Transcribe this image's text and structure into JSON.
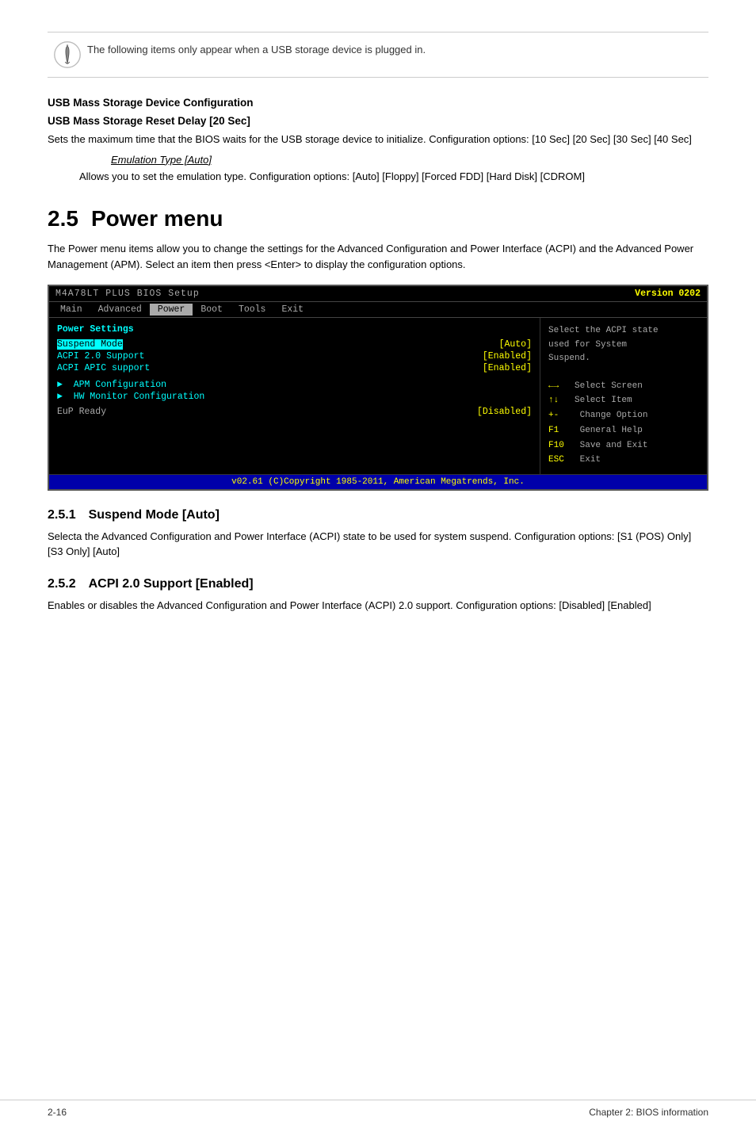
{
  "notice": {
    "text": "The following items only appear when a USB storage device is plugged in."
  },
  "usb_section": {
    "heading": "USB Mass Storage Device Configuration",
    "reset_delay_heading": "USB Mass Storage Reset Delay [20 Sec]",
    "reset_delay_body": "Sets the maximum time that the BIOS waits for the USB storage device to initialize. Configuration options: [10 Sec] [20 Sec] [30 Sec] [40 Sec]",
    "emulation_label": "Emulation Type [Auto]",
    "emulation_body": "Allows you to set the emulation type. Configuration options: [Auto] [Floppy] [Forced FDD] [Hard Disk] [CDROM]"
  },
  "power_section": {
    "num": "2.5",
    "title": "Power menu",
    "body": "The Power menu items allow you to change the settings for the Advanced Configuration and Power Interface (ACPI) and the Advanced Power Management (APM). Select an item then press <Enter> to display the configuration options.",
    "bios": {
      "header_title": "M4A78LT PLUS BIOS Setup",
      "version": "Version 0202",
      "menu_items": [
        "Main",
        "Advanced",
        "Power",
        "Boot",
        "Tools",
        "Exit"
      ],
      "active_menu": "Power",
      "section_label": "Power Settings",
      "rows": [
        {
          "key": "Suspend Mode",
          "val": "[Auto]",
          "highlight": true
        },
        {
          "key": "ACPI 2.0 Support",
          "val": "[Enabled]",
          "highlight": false
        },
        {
          "key": "ACPI APIC support",
          "val": "[Enabled]",
          "highlight": false
        }
      ],
      "submenus": [
        "APM Configuration",
        "HW Monitor Configuration"
      ],
      "eup_key": "EuP Ready",
      "eup_val": "[Disabled]",
      "right_help_lines": [
        "Select the ACPI state",
        "used for System",
        "Suspend."
      ],
      "right_keys": [
        {
          "sym": "↔",
          "label": "Select Screen"
        },
        {
          "sym": "↕",
          "label": "Select Item"
        },
        {
          "sym": "+-",
          "label": "Change Option"
        },
        {
          "sym": "F1",
          "label": "General Help"
        },
        {
          "sym": "F10",
          "label": "Save and Exit"
        },
        {
          "sym": "ESC",
          "label": "Exit"
        }
      ],
      "footer": "v02.61 (C)Copyright 1985-2011, American Megatrends, Inc."
    }
  },
  "subsections": [
    {
      "num": "2.5.1",
      "title": "Suspend Mode [Auto]",
      "body": "Selecta the Advanced Configuration and Power Interface (ACPI) state to be used for system suspend. Configuration options: [S1 (POS) Only] [S3 Only] [Auto]"
    },
    {
      "num": "2.5.2",
      "title": "ACPI 2.0 Support [Enabled]",
      "body": "Enables or disables the Advanced Configuration and Power Interface (ACPI) 2.0 support. Configuration options: [Disabled] [Enabled]"
    }
  ],
  "footer": {
    "left": "2-16",
    "right": "Chapter 2: BIOS information"
  }
}
